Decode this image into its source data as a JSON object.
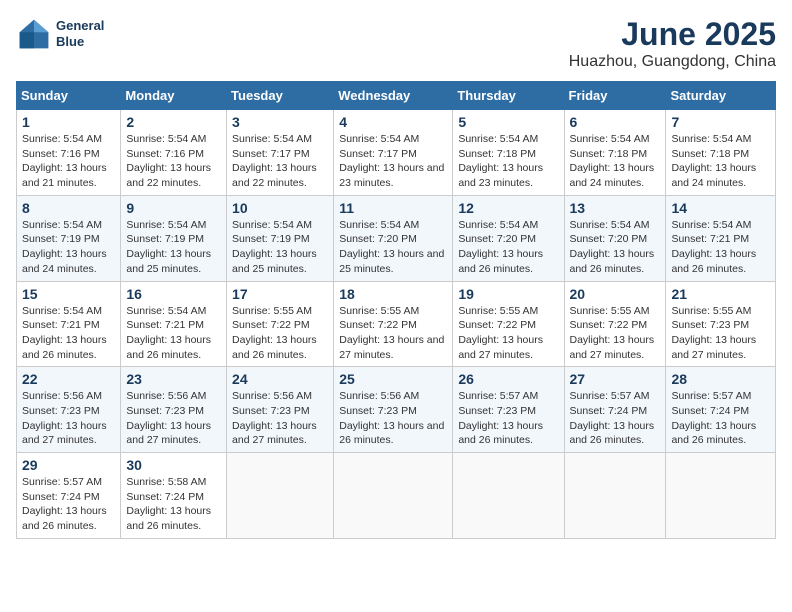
{
  "header": {
    "logo_line1": "General",
    "logo_line2": "Blue",
    "title": "June 2025",
    "subtitle": "Huazhou, Guangdong, China"
  },
  "calendar": {
    "days_of_week": [
      "Sunday",
      "Monday",
      "Tuesday",
      "Wednesday",
      "Thursday",
      "Friday",
      "Saturday"
    ],
    "weeks": [
      [
        null,
        {
          "day": "2",
          "sunrise": "5:54 AM",
          "sunset": "7:16 PM",
          "daylight": "13 hours and 22 minutes."
        },
        {
          "day": "3",
          "sunrise": "5:54 AM",
          "sunset": "7:17 PM",
          "daylight": "13 hours and 22 minutes."
        },
        {
          "day": "4",
          "sunrise": "5:54 AM",
          "sunset": "7:17 PM",
          "daylight": "13 hours and 23 minutes."
        },
        {
          "day": "5",
          "sunrise": "5:54 AM",
          "sunset": "7:18 PM",
          "daylight": "13 hours and 23 minutes."
        },
        {
          "day": "6",
          "sunrise": "5:54 AM",
          "sunset": "7:18 PM",
          "daylight": "13 hours and 24 minutes."
        },
        {
          "day": "7",
          "sunrise": "5:54 AM",
          "sunset": "7:18 PM",
          "daylight": "13 hours and 24 minutes."
        }
      ],
      [
        {
          "day": "1",
          "sunrise": "5:54 AM",
          "sunset": "7:16 PM",
          "daylight": "13 hours and 21 minutes."
        },
        null,
        null,
        null,
        null,
        null,
        null
      ],
      [
        {
          "day": "8",
          "sunrise": "5:54 AM",
          "sunset": "7:19 PM",
          "daylight": "13 hours and 24 minutes."
        },
        {
          "day": "9",
          "sunrise": "5:54 AM",
          "sunset": "7:19 PM",
          "daylight": "13 hours and 25 minutes."
        },
        {
          "day": "10",
          "sunrise": "5:54 AM",
          "sunset": "7:19 PM",
          "daylight": "13 hours and 25 minutes."
        },
        {
          "day": "11",
          "sunrise": "5:54 AM",
          "sunset": "7:20 PM",
          "daylight": "13 hours and 25 minutes."
        },
        {
          "day": "12",
          "sunrise": "5:54 AM",
          "sunset": "7:20 PM",
          "daylight": "13 hours and 26 minutes."
        },
        {
          "day": "13",
          "sunrise": "5:54 AM",
          "sunset": "7:20 PM",
          "daylight": "13 hours and 26 minutes."
        },
        {
          "day": "14",
          "sunrise": "5:54 AM",
          "sunset": "7:21 PM",
          "daylight": "13 hours and 26 minutes."
        }
      ],
      [
        {
          "day": "15",
          "sunrise": "5:54 AM",
          "sunset": "7:21 PM",
          "daylight": "13 hours and 26 minutes."
        },
        {
          "day": "16",
          "sunrise": "5:54 AM",
          "sunset": "7:21 PM",
          "daylight": "13 hours and 26 minutes."
        },
        {
          "day": "17",
          "sunrise": "5:55 AM",
          "sunset": "7:22 PM",
          "daylight": "13 hours and 26 minutes."
        },
        {
          "day": "18",
          "sunrise": "5:55 AM",
          "sunset": "7:22 PM",
          "daylight": "13 hours and 27 minutes."
        },
        {
          "day": "19",
          "sunrise": "5:55 AM",
          "sunset": "7:22 PM",
          "daylight": "13 hours and 27 minutes."
        },
        {
          "day": "20",
          "sunrise": "5:55 AM",
          "sunset": "7:22 PM",
          "daylight": "13 hours and 27 minutes."
        },
        {
          "day": "21",
          "sunrise": "5:55 AM",
          "sunset": "7:23 PM",
          "daylight": "13 hours and 27 minutes."
        }
      ],
      [
        {
          "day": "22",
          "sunrise": "5:56 AM",
          "sunset": "7:23 PM",
          "daylight": "13 hours and 27 minutes."
        },
        {
          "day": "23",
          "sunrise": "5:56 AM",
          "sunset": "7:23 PM",
          "daylight": "13 hours and 27 minutes."
        },
        {
          "day": "24",
          "sunrise": "5:56 AM",
          "sunset": "7:23 PM",
          "daylight": "13 hours and 27 minutes."
        },
        {
          "day": "25",
          "sunrise": "5:56 AM",
          "sunset": "7:23 PM",
          "daylight": "13 hours and 26 minutes."
        },
        {
          "day": "26",
          "sunrise": "5:57 AM",
          "sunset": "7:23 PM",
          "daylight": "13 hours and 26 minutes."
        },
        {
          "day": "27",
          "sunrise": "5:57 AM",
          "sunset": "7:24 PM",
          "daylight": "13 hours and 26 minutes."
        },
        {
          "day": "28",
          "sunrise": "5:57 AM",
          "sunset": "7:24 PM",
          "daylight": "13 hours and 26 minutes."
        }
      ],
      [
        {
          "day": "29",
          "sunrise": "5:57 AM",
          "sunset": "7:24 PM",
          "daylight": "13 hours and 26 minutes."
        },
        {
          "day": "30",
          "sunrise": "5:58 AM",
          "sunset": "7:24 PM",
          "daylight": "13 hours and 26 minutes."
        },
        null,
        null,
        null,
        null,
        null
      ]
    ]
  }
}
